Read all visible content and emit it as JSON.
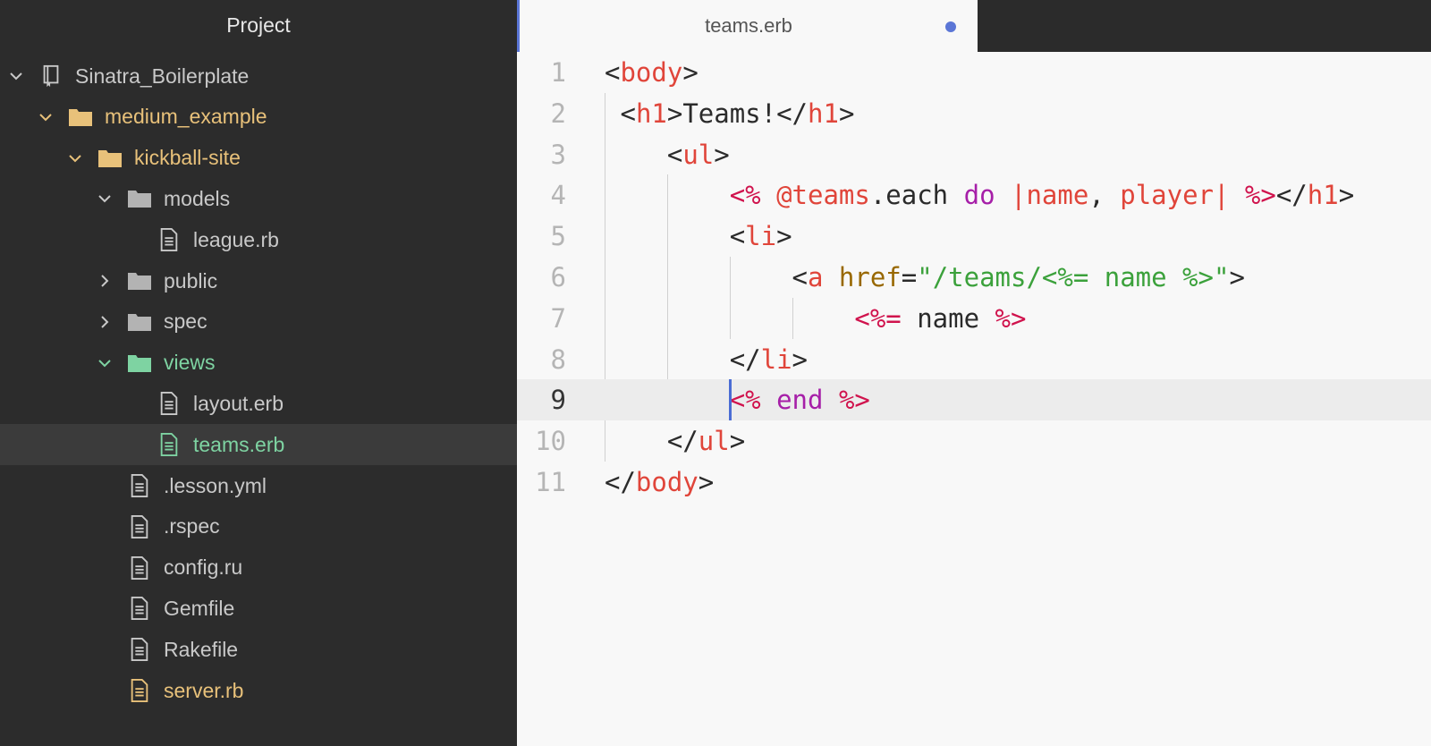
{
  "sidebar": {
    "title": "Project",
    "items": [
      {
        "label": "Sinatra_Boilerplate",
        "type": "repo",
        "expanded": true,
        "depth": 0,
        "color": "gray"
      },
      {
        "label": "medium_example",
        "type": "folder",
        "expanded": true,
        "depth": 1,
        "color": "yellow"
      },
      {
        "label": "kickball-site",
        "type": "folder",
        "expanded": true,
        "depth": 2,
        "color": "yellow"
      },
      {
        "label": "models",
        "type": "folder",
        "expanded": true,
        "depth": 3,
        "color": "gray"
      },
      {
        "label": "league.rb",
        "type": "file",
        "depth": 4,
        "color": "gray"
      },
      {
        "label": "public",
        "type": "folder",
        "expanded": false,
        "depth": 3,
        "color": "gray"
      },
      {
        "label": "spec",
        "type": "folder",
        "expanded": false,
        "depth": 3,
        "color": "gray"
      },
      {
        "label": "views",
        "type": "folder",
        "expanded": true,
        "depth": 3,
        "color": "green"
      },
      {
        "label": "layout.erb",
        "type": "file",
        "depth": 4,
        "color": "gray"
      },
      {
        "label": "teams.erb",
        "type": "file",
        "depth": 4,
        "color": "green",
        "selected": true
      },
      {
        "label": ".lesson.yml",
        "type": "file",
        "depth": 3,
        "color": "gray"
      },
      {
        "label": ".rspec",
        "type": "file",
        "depth": 3,
        "color": "gray"
      },
      {
        "label": "config.ru",
        "type": "file",
        "depth": 3,
        "color": "gray"
      },
      {
        "label": "Gemfile",
        "type": "file",
        "depth": 3,
        "color": "gray"
      },
      {
        "label": "Rakefile",
        "type": "file",
        "depth": 3,
        "color": "gray"
      },
      {
        "label": "server.rb",
        "type": "file",
        "depth": 3,
        "color": "yellow"
      }
    ]
  },
  "tab": {
    "title": "teams.erb",
    "modified": true
  },
  "editor": {
    "current_line": 9,
    "lines": [
      {
        "no": "1",
        "tokens": [
          [
            "punc",
            "<"
          ],
          [
            "tag",
            "body"
          ],
          [
            "punc",
            ">"
          ]
        ]
      },
      {
        "no": "2",
        "tokens": [
          [
            "text",
            " "
          ],
          [
            "punc",
            "<"
          ],
          [
            "tag",
            "h1"
          ],
          [
            "punc",
            ">"
          ],
          [
            "text",
            "Teams!"
          ],
          [
            "punc",
            "</"
          ],
          [
            "tag",
            "h1"
          ],
          [
            "punc",
            ">"
          ]
        ]
      },
      {
        "no": "3",
        "tokens": [
          [
            "text",
            "    "
          ],
          [
            "punc",
            "<"
          ],
          [
            "tag",
            "ul"
          ],
          [
            "punc",
            ">"
          ]
        ]
      },
      {
        "no": "4",
        "tokens": [
          [
            "text",
            "        "
          ],
          [
            "erb",
            "<%"
          ],
          [
            "text",
            " "
          ],
          [
            "ivar",
            "@teams"
          ],
          [
            "text",
            ".each "
          ],
          [
            "kw",
            "do"
          ],
          [
            "text",
            " "
          ],
          [
            "ivar",
            "|name"
          ],
          [
            "text",
            ", "
          ],
          [
            "ivar",
            "player|"
          ],
          [
            "text",
            " "
          ],
          [
            "erb",
            "%>"
          ],
          [
            "punc",
            "</"
          ],
          [
            "tag",
            "h1"
          ],
          [
            "punc",
            ">"
          ]
        ]
      },
      {
        "no": "5",
        "tokens": [
          [
            "text",
            "        "
          ],
          [
            "punc",
            "<"
          ],
          [
            "tag",
            "li"
          ],
          [
            "punc",
            ">"
          ]
        ]
      },
      {
        "no": "6",
        "tokens": [
          [
            "text",
            "            "
          ],
          [
            "punc",
            "<"
          ],
          [
            "tag",
            "a"
          ],
          [
            "text",
            " "
          ],
          [
            "attr",
            "href"
          ],
          [
            "punc",
            "="
          ],
          [
            "str",
            "\"/teams/<%= name %>\""
          ],
          [
            "punc",
            ">"
          ]
        ]
      },
      {
        "no": "7",
        "tokens": [
          [
            "text",
            "                "
          ],
          [
            "erb",
            "<%="
          ],
          [
            "text",
            " name "
          ],
          [
            "erb",
            "%>"
          ]
        ]
      },
      {
        "no": "8",
        "tokens": [
          [
            "text",
            "        "
          ],
          [
            "punc",
            "</"
          ],
          [
            "tag",
            "li"
          ],
          [
            "punc",
            ">"
          ]
        ]
      },
      {
        "no": "9",
        "tokens": [
          [
            "text",
            "        "
          ],
          [
            "erb",
            "<%"
          ],
          [
            "text",
            " "
          ],
          [
            "kw",
            "end"
          ],
          [
            "text",
            " "
          ],
          [
            "erb",
            "%>"
          ]
        ]
      },
      {
        "no": "10",
        "tokens": [
          [
            "text",
            "    "
          ],
          [
            "punc",
            "</"
          ],
          [
            "tag",
            "ul"
          ],
          [
            "punc",
            ">"
          ]
        ]
      },
      {
        "no": "11",
        "tokens": [
          [
            "punc",
            "</"
          ],
          [
            "tag",
            "body"
          ],
          [
            "punc",
            ">"
          ]
        ]
      }
    ]
  },
  "colors": {
    "sidebar_bg": "#2c2c2c",
    "editor_bg": "#f8f8f8",
    "accent": "#5b76d6",
    "folder_yellow": "#e8c17a",
    "folder_green": "#7ed3a2"
  }
}
